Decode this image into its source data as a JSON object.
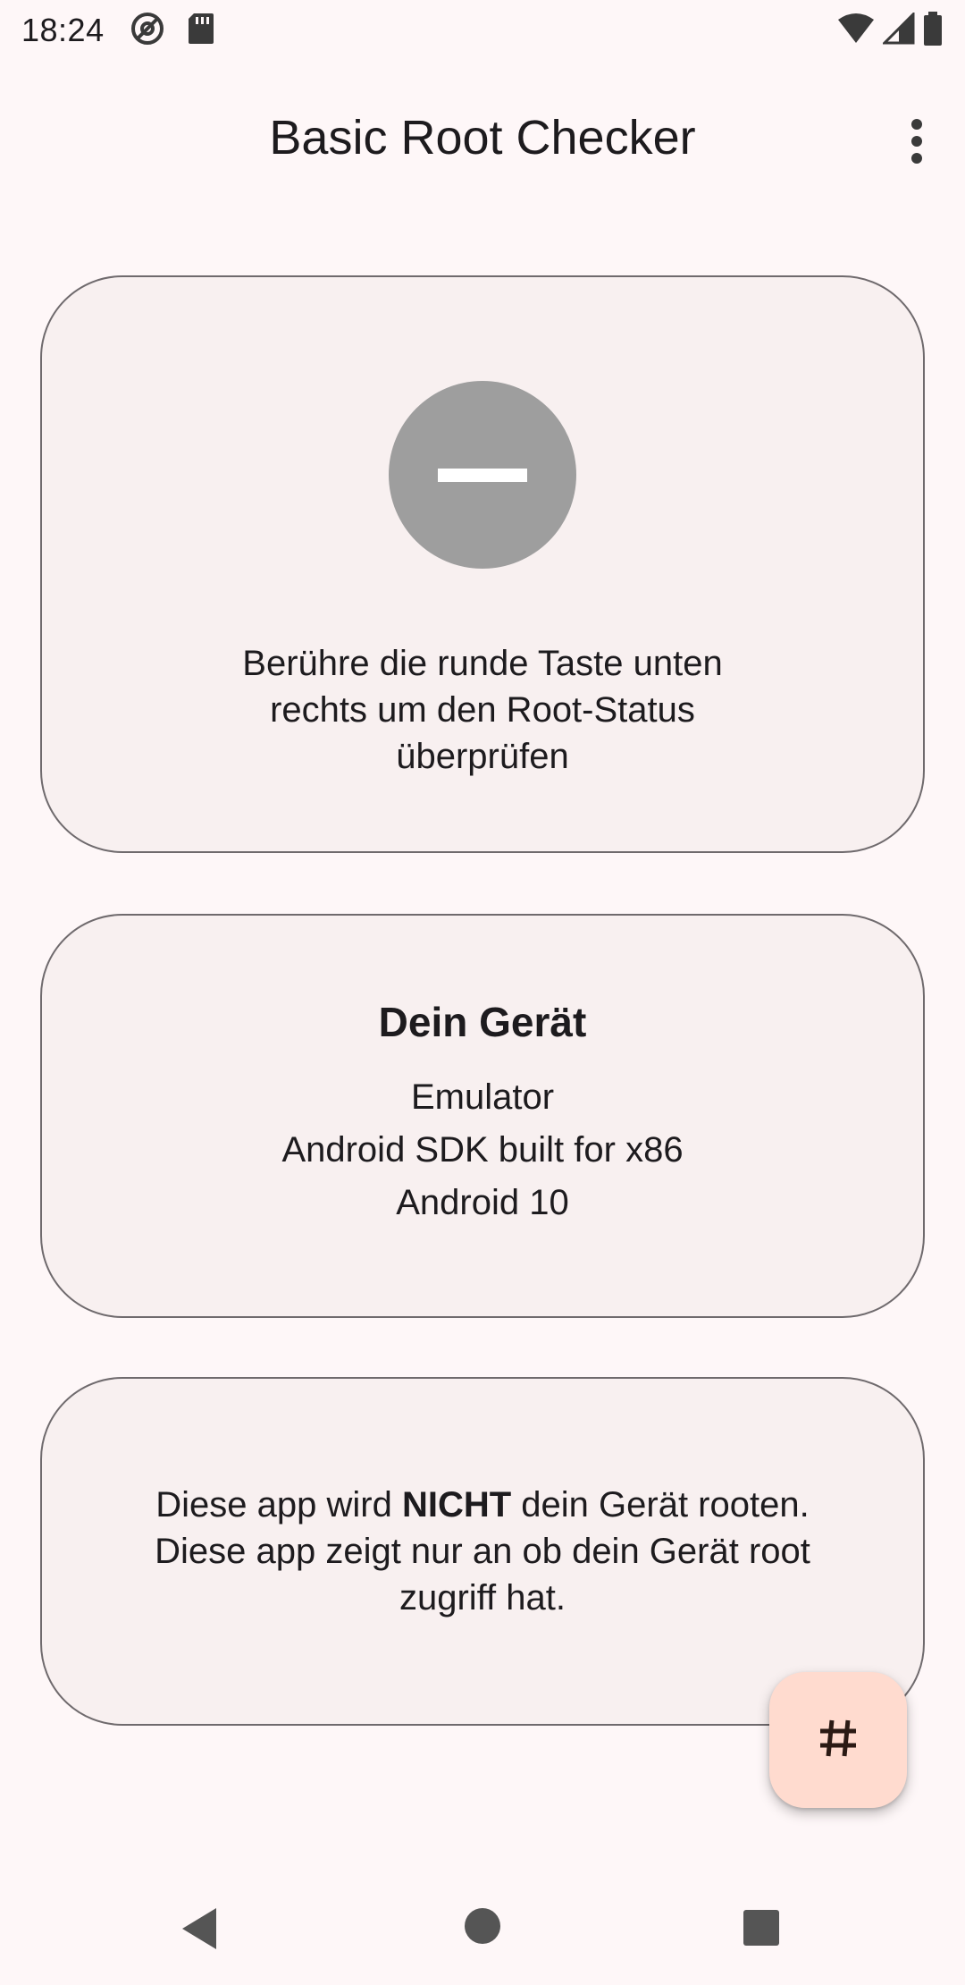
{
  "status_bar": {
    "time": "18:24",
    "icons": [
      "at-sign-icon",
      "sd-card-icon",
      "wifi-icon",
      "signal-icon",
      "battery-icon"
    ]
  },
  "app_bar": {
    "title": "Basic Root Checker",
    "menu_icon": "more-vert-icon"
  },
  "root_status_card": {
    "status_icon": "minus-circle-icon",
    "status_color": "#9e9e9e",
    "message": "Berühre die runde Taste unten rechts um den Root-Status überprüfen"
  },
  "device_card": {
    "title": "Dein Gerät",
    "lines": [
      "Emulator",
      "Android SDK built for x86",
      "Android 10"
    ]
  },
  "disclaimer_card": {
    "line1_prefix": "Diese app wird ",
    "line1_bold": "NICHT",
    "line1_suffix": " dein Gerät rooten.",
    "line2": "Diese app zeigt nur an ob dein Gerät root zugriff hat."
  },
  "fab": {
    "icon": "hash-icon",
    "color": "#ffdbcf"
  },
  "nav_bar": {
    "icons": [
      "back-icon",
      "home-icon",
      "recents-icon"
    ]
  },
  "colors": {
    "background": "#fef7f8",
    "card_background": "#f8f0f0",
    "card_border": "#6f6a6d"
  }
}
